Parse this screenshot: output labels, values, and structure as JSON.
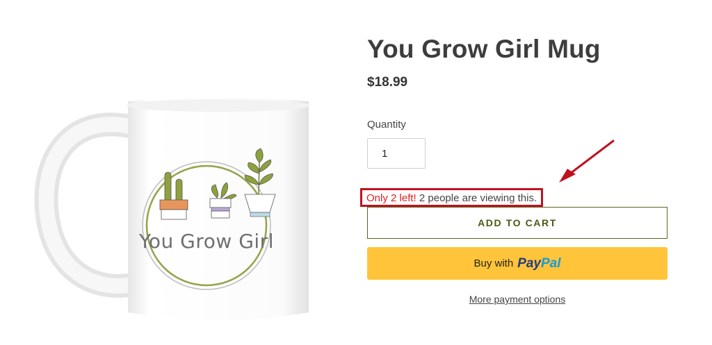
{
  "product": {
    "title": "You Grow Girl Mug",
    "price": "$18.99",
    "image": {
      "mug_text": "You Grow Girl",
      "icon": "mug-with-potted-plants-icon"
    }
  },
  "quantity": {
    "label": "Quantity",
    "value": "1"
  },
  "stock_notice": {
    "urgency": "Only 2 left!",
    "viewers": "2 people are viewing this."
  },
  "buttons": {
    "add_to_cart": "ADD TO CART",
    "paypal_prefix": "Buy with",
    "paypal_pay": "Pay",
    "paypal_pal": "Pal",
    "more_payment": "More payment options"
  },
  "colors": {
    "highlight_border": "#c0111f",
    "urgency_text": "#e02020",
    "paypal_button": "#ffc43a",
    "add_to_cart_border": "#57661f"
  }
}
